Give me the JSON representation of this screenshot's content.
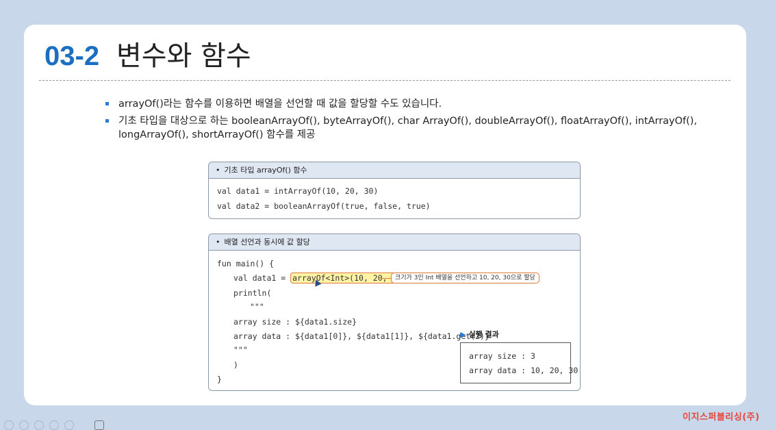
{
  "slide": {
    "title_number": "03-2",
    "title_text": "변수와 함수",
    "bullets": [
      "arrayOf()라는 함수를 이용하면 배열을 선언할 때 값을 할당할 수도 있습니다.",
      "기초 타입을 대상으로 하는 booleanArrayOf(), byteArrayOf(), char ArrayOf(), doubleArrayOf(), floatArrayOf(), intArrayOf(), longArrayOf(), shortArrayOf() 함수를 제공"
    ]
  },
  "box1": {
    "header": "기초 타입 arrayOf() 함수",
    "lines": [
      "val data1 = intArrayOf(10, 20, 30)",
      "val data2 = booleanArrayOf(true, false, true)"
    ]
  },
  "box2": {
    "header": "배열 선언과 동시에 값 할당",
    "line_main": "fun main() {",
    "line_val_prefix": "val data1 = ",
    "line_val_highlight": "arrayOf<Int>(10, 20, 30)",
    "line_println": "println(",
    "line_quote_open": "\"\"\"",
    "line_size": "array size : ${data1.size}",
    "line_data": "array data : ${data1[0]}, ${data1[1]}, ${data1.get(2)}",
    "line_quote_close": "\"\"\"",
    "line_paren_close": ")",
    "line_brace_close": "}",
    "annotation": "크기가 3인 Int 배열을 선언하고 10, 20, 30으로 할당",
    "result_label": "실행 결과",
    "result_lines": [
      "array size : 3",
      "array data : 10, 20, 30"
    ]
  },
  "footer": {
    "publisher": "이지스퍼블리싱(주)"
  },
  "colors": {
    "accent": "#1a6fc0",
    "highlight_border": "#e07a3a",
    "highlight_fill": "#fff3a6",
    "logo": "#e8453c"
  }
}
